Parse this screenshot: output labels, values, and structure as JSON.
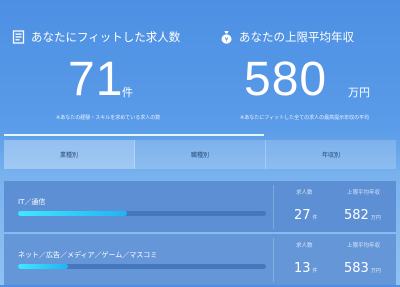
{
  "jobs_stat": {
    "title": "あなたにフィットした求人数",
    "value": "71",
    "unit": "件",
    "note": "※あなたの経験・スキルを求めている求人の数",
    "icon": "document-icon"
  },
  "salary_stat": {
    "title": "あなたの上限平均年収",
    "value": "580",
    "unit": "万円",
    "note": "※あなたにフィットした全ての求人の最高提示年収の平均",
    "icon": "money-bag-icon"
  },
  "tabs": [
    {
      "label": "業種別",
      "active": true
    },
    {
      "label": "職種別",
      "active": false
    },
    {
      "label": "年収別",
      "active": false
    }
  ],
  "list_headers": {
    "count": "求人数",
    "salary": "上限平均年収"
  },
  "rows": [
    {
      "label": "IT／通信",
      "progress": 0.44,
      "count": "27",
      "count_unit": "件",
      "salary": "582",
      "salary_unit": "万円"
    },
    {
      "label": "ネット／広告／メディア／ゲーム／マスコミ",
      "progress": 0.2,
      "count": "13",
      "count_unit": "件",
      "salary": "583",
      "salary_unit": "万円"
    }
  ],
  "colors": {
    "accent": "#3fe8ff",
    "background_top": "#4d8fe3",
    "background_bottom": "#8ec3f1"
  }
}
